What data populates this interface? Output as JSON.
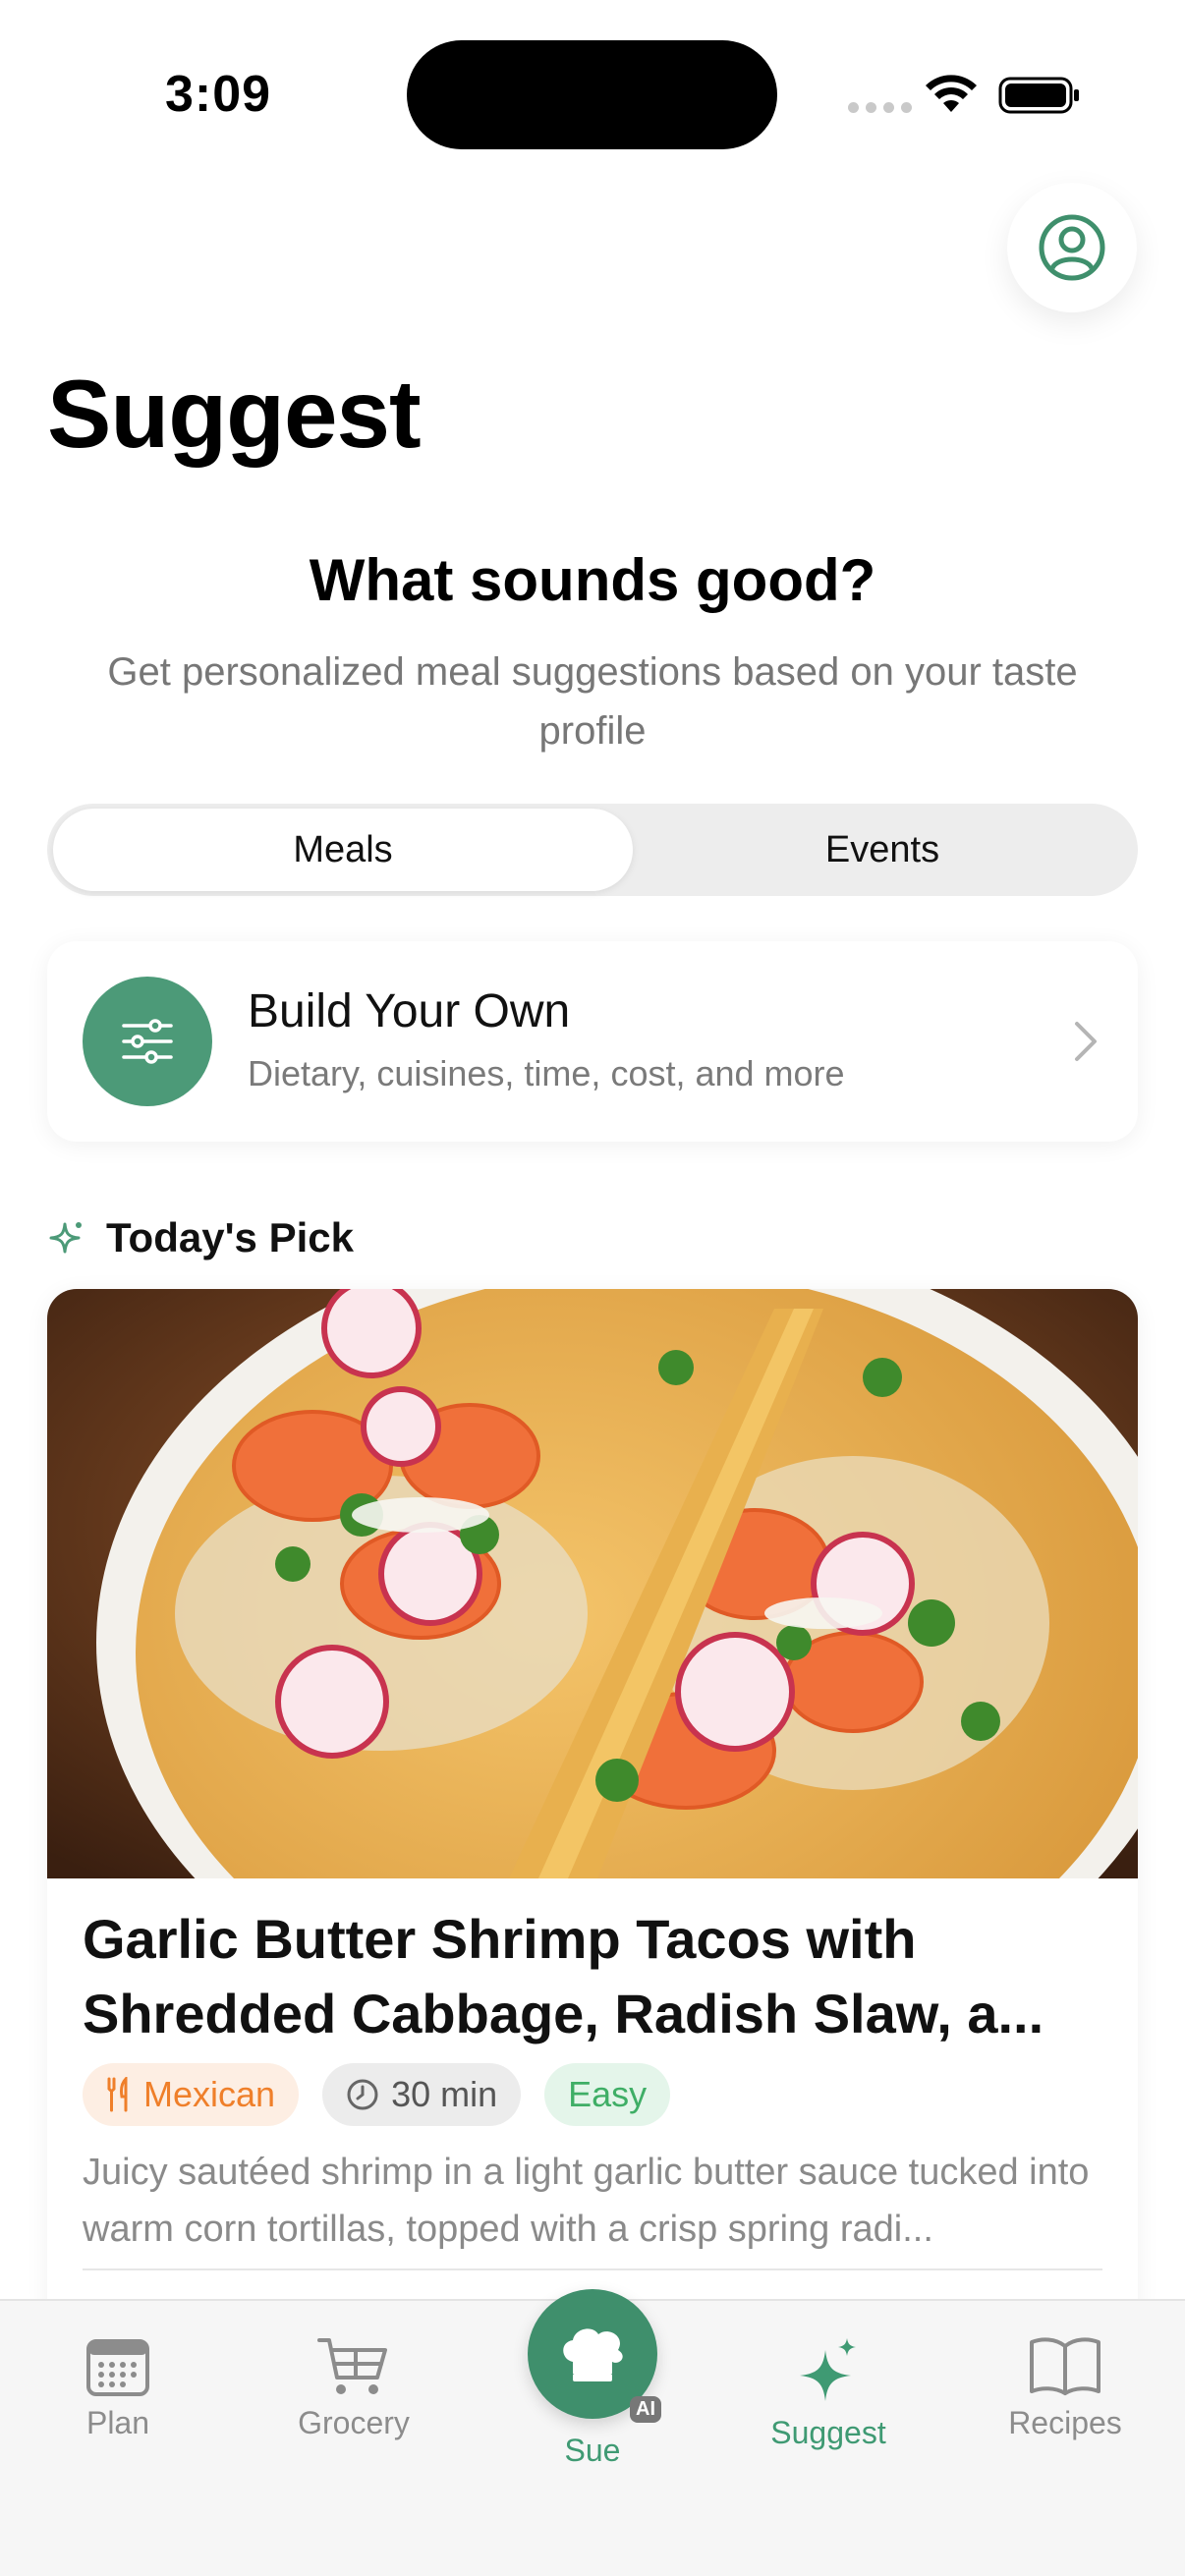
{
  "status_bar": {
    "time": "3:09"
  },
  "header": {
    "title": "Suggest"
  },
  "hero": {
    "title": "What sounds good?",
    "subtitle": "Get personalized meal suggestions based on your taste profile"
  },
  "segmented": {
    "meals_label": "Meals",
    "events_label": "Events",
    "selected": "Meals"
  },
  "build_card": {
    "title": "Build Your Own",
    "subtitle": "Dietary, cuisines, time, cost, and more"
  },
  "todays_pick": {
    "label": "Today's Pick",
    "recipe": {
      "title": "Garlic Butter Shrimp Tacos with Shredded Cabbage, Radish Slaw, a...",
      "cuisine": "Mexican",
      "time": "30 min",
      "difficulty": "Easy",
      "description": "Juicy sautéed shrimp in a light garlic butter sauce tucked into warm corn tortillas, topped with a crisp spring radi..."
    }
  },
  "tab_bar": {
    "plan": "Plan",
    "grocery": "Grocery",
    "sue": "Sue",
    "sue_badge": "AI",
    "suggest": "Suggest",
    "recipes": "Recipes",
    "active": "Suggest"
  },
  "colors": {
    "accent": "#3f9a73",
    "cuisine_tag": "#ef7f2a",
    "easy_tag": "#3fae66"
  }
}
